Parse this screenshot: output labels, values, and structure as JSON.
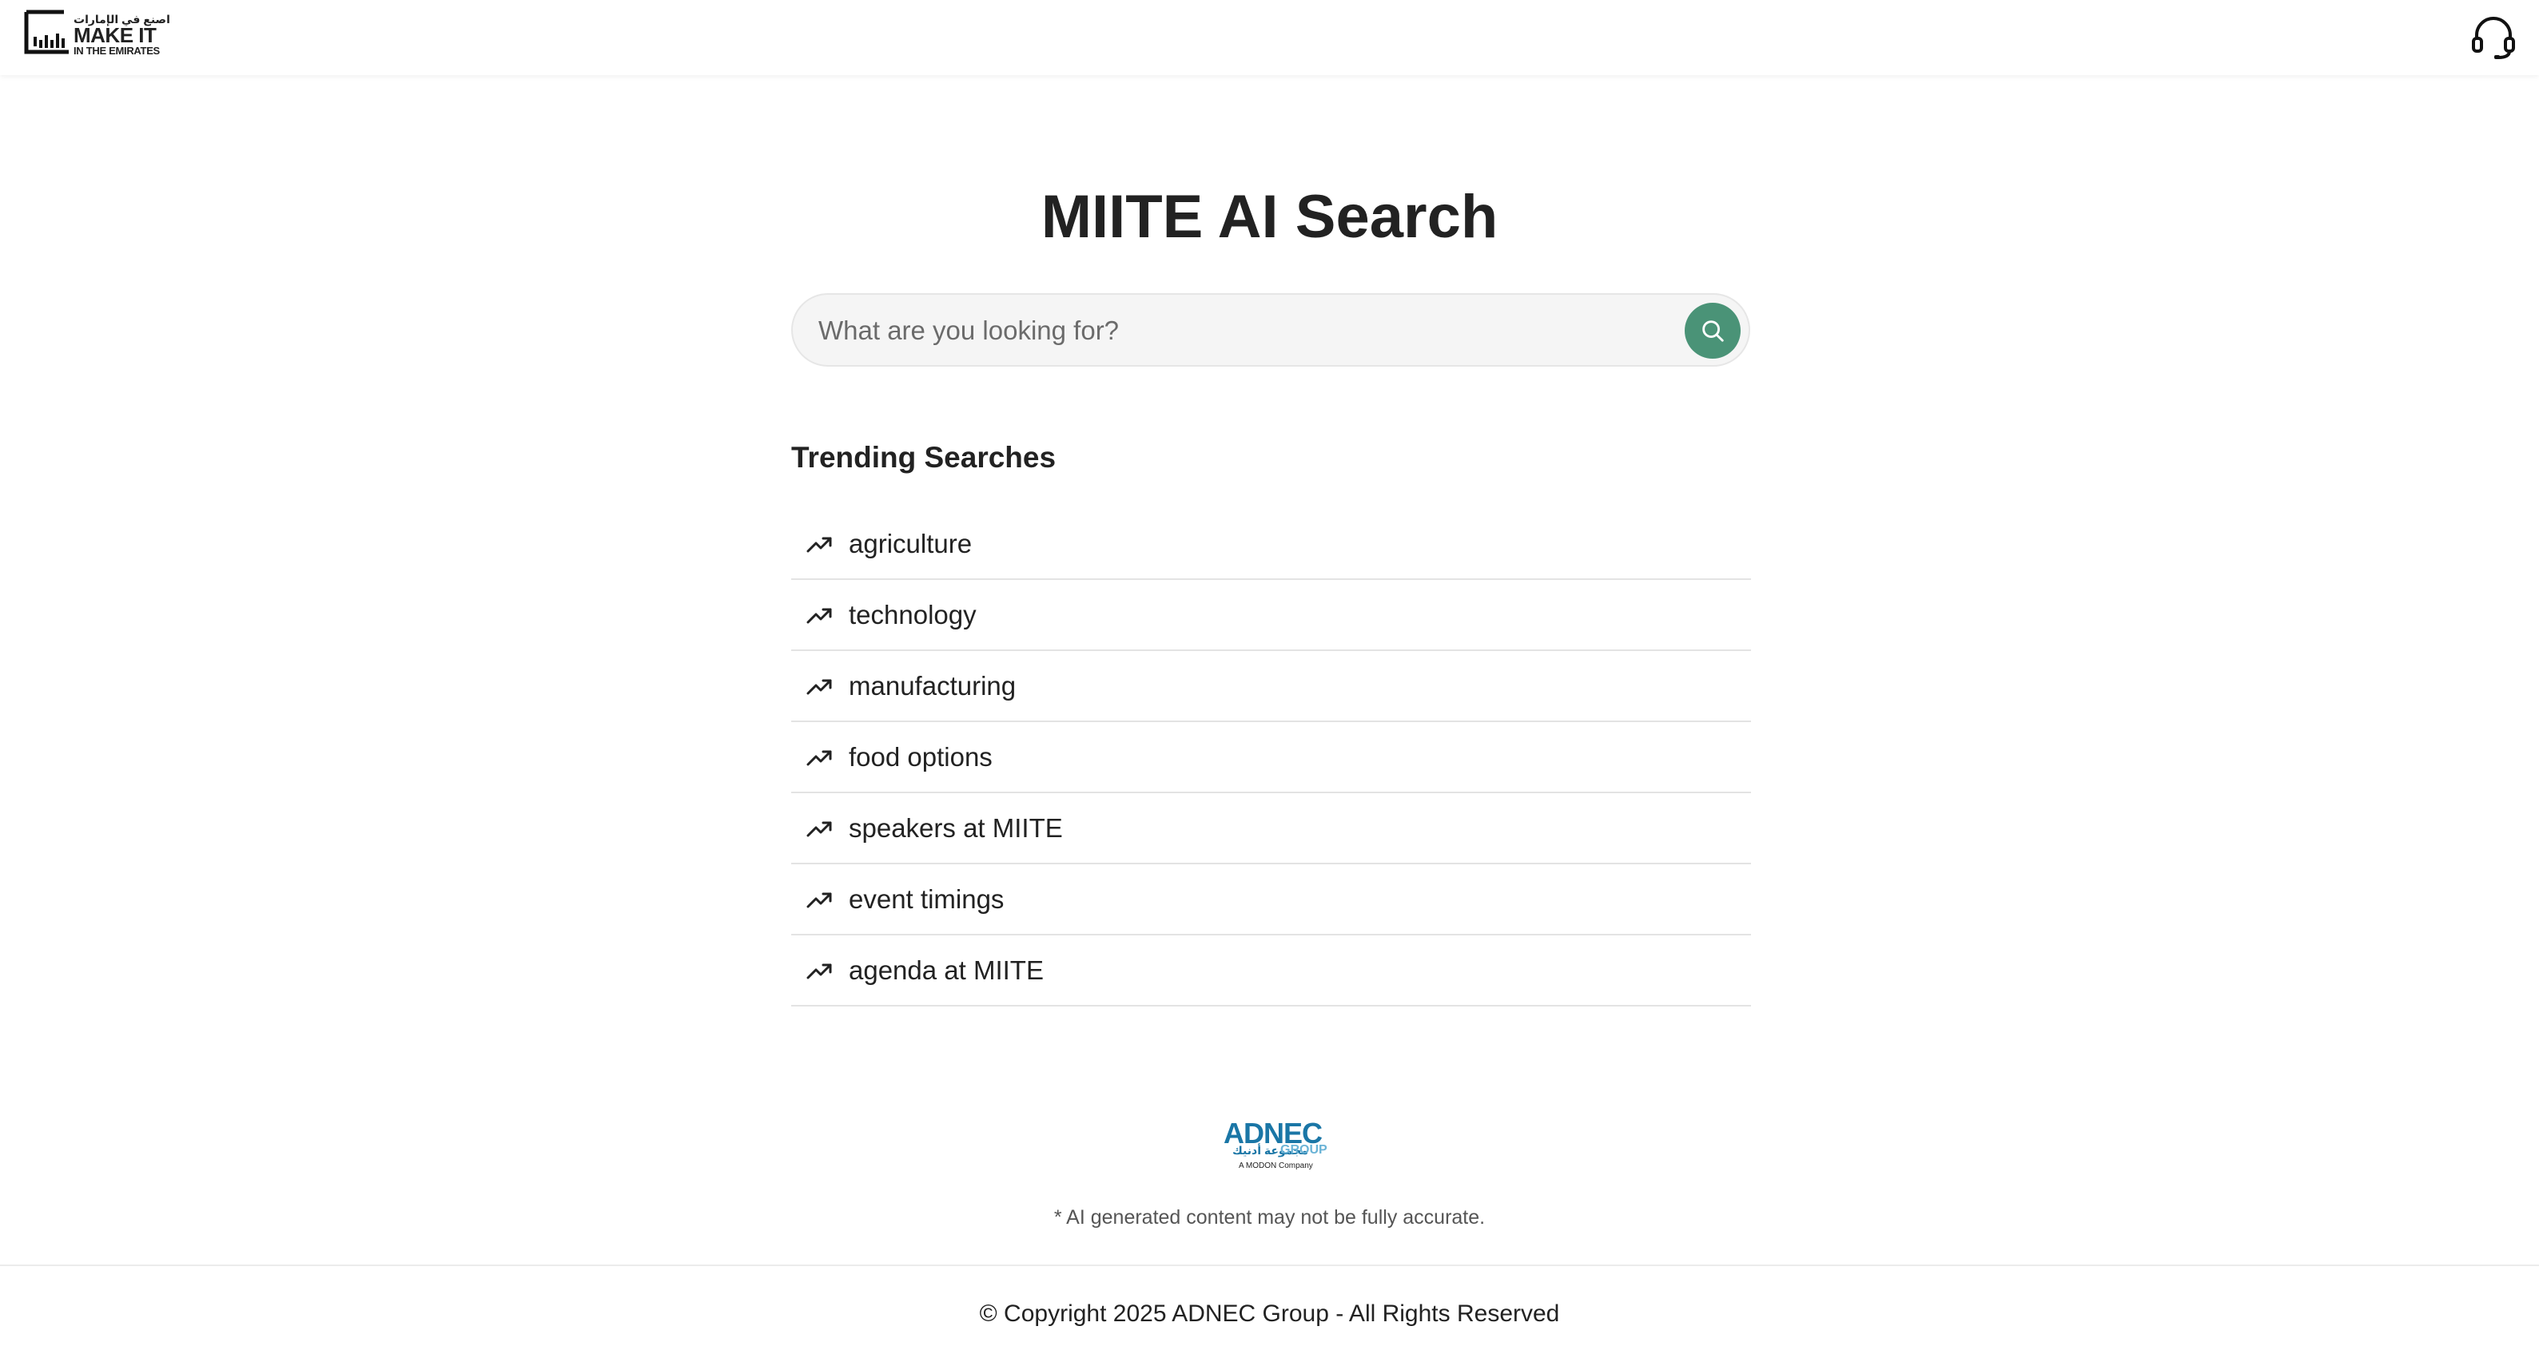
{
  "header": {
    "logo": {
      "arabic_text": "اصنع في الإمارات",
      "main_text": "MAKE IT",
      "sub_text": "IN THE EMIRATES"
    },
    "support_icon": "headset-icon"
  },
  "main": {
    "title": "MIITE AI Search",
    "search": {
      "placeholder": "What are you looking for?",
      "value": "",
      "button_icon": "search-icon"
    },
    "trending": {
      "heading": "Trending Searches",
      "item_icon": "trending-up-icon",
      "items": [
        {
          "label": "agriculture"
        },
        {
          "label": "technology"
        },
        {
          "label": "manufacturing"
        },
        {
          "label": "food options"
        },
        {
          "label": "speakers at MIITE"
        },
        {
          "label": "event timings"
        },
        {
          "label": "agenda at MIITE"
        }
      ]
    }
  },
  "footer": {
    "adnec_logo": {
      "main_text": "ADNEC",
      "arabic_text": "مجموعة أدنيك",
      "group_text": "GROUP",
      "sub_text": "A MODON Company"
    },
    "disclaimer": "* AI generated content may not be fully accurate.",
    "copyright": "© Copyright 2025 ADNEC Group - All Rights Reserved"
  },
  "colors": {
    "accent": "#4a9377",
    "brand_blue": "#1a76a6",
    "text": "#222222",
    "divider": "#e3e3e3"
  }
}
